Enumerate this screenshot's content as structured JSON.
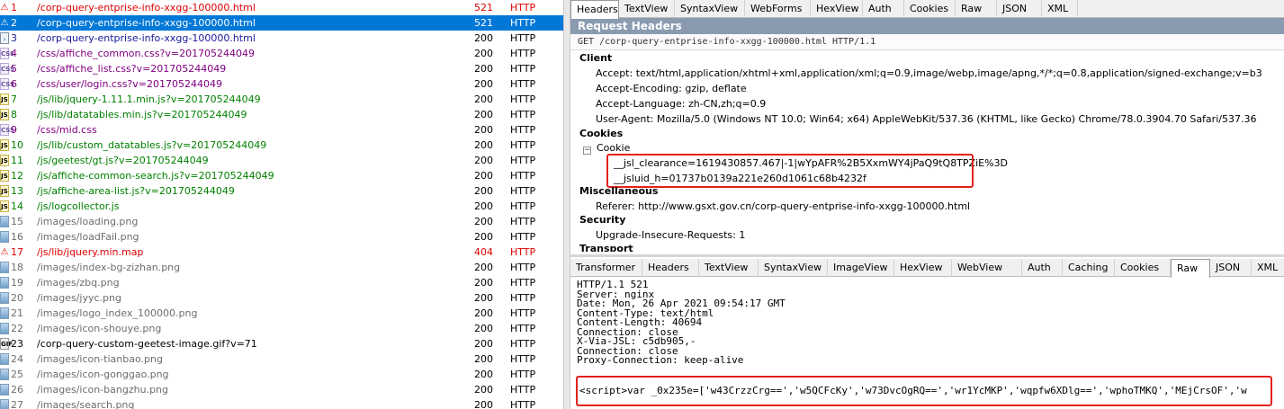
{
  "sessions": [
    {
      "num": "1",
      "icon": "warning-icon",
      "url": "/corp-query-entprise-info-xxgg-100000.html",
      "result": "521",
      "protocol": "HTTP",
      "color": "red"
    },
    {
      "num": "2",
      "icon": "warning-icon",
      "url": "/corp-query-entprise-info-xxgg-100000.html",
      "result": "521",
      "protocol": "HTTP",
      "color": "red",
      "selected": true
    },
    {
      "num": "3",
      "icon": "document-icon",
      "url": "/corp-query-entprise-info-xxgg-100000.html",
      "result": "200",
      "protocol": "HTTP",
      "color": "blue"
    },
    {
      "num": "4",
      "icon": "css-icon",
      "url": "/css/affiche_common.css?v=201705244049",
      "result": "200",
      "protocol": "HTTP",
      "color": "purple"
    },
    {
      "num": "5",
      "icon": "css-icon",
      "url": "/css/affiche_list.css?v=201705244049",
      "result": "200",
      "protocol": "HTTP",
      "color": "purple"
    },
    {
      "num": "6",
      "icon": "css-icon",
      "url": "/css/user/login.css?v=201705244049",
      "result": "200",
      "protocol": "HTTP",
      "color": "purple"
    },
    {
      "num": "7",
      "icon": "js-icon",
      "url": "/js/lib/jquery-1.11.1.min.js?v=201705244049",
      "result": "200",
      "protocol": "HTTP",
      "color": "green"
    },
    {
      "num": "8",
      "icon": "js-icon",
      "url": "/js/lib/datatables.min.js?v=201705244049",
      "result": "200",
      "protocol": "HTTP",
      "color": "green"
    },
    {
      "num": "9",
      "icon": "css-icon",
      "url": "/css/mid.css",
      "result": "200",
      "protocol": "HTTP",
      "color": "purple"
    },
    {
      "num": "10",
      "icon": "js-icon",
      "url": "/js/lib/custom_datatables.js?v=201705244049",
      "result": "200",
      "protocol": "HTTP",
      "color": "green"
    },
    {
      "num": "11",
      "icon": "js-icon",
      "url": "/js/geetest/gt.js?v=201705244049",
      "result": "200",
      "protocol": "HTTP",
      "color": "green"
    },
    {
      "num": "12",
      "icon": "js-icon",
      "url": "/js/affiche-common-search.js?v=201705244049",
      "result": "200",
      "protocol": "HTTP",
      "color": "green"
    },
    {
      "num": "13",
      "icon": "js-icon",
      "url": "/js/affiche-area-list.js?v=201705244049",
      "result": "200",
      "protocol": "HTTP",
      "color": "green"
    },
    {
      "num": "14",
      "icon": "js-icon",
      "url": "/js/logcollector.js",
      "result": "200",
      "protocol": "HTTP",
      "color": "green"
    },
    {
      "num": "15",
      "icon": "image-icon",
      "url": "/images/loading.png",
      "result": "200",
      "protocol": "HTTP",
      "color": "gray"
    },
    {
      "num": "16",
      "icon": "image-icon",
      "url": "/images/loadFail.png",
      "result": "200",
      "protocol": "HTTP",
      "color": "gray"
    },
    {
      "num": "17",
      "icon": "warning-icon",
      "url": "/js/lib/jquery.min.map",
      "result": "404",
      "protocol": "HTTP",
      "color": "red"
    },
    {
      "num": "18",
      "icon": "image-icon",
      "url": "/images/index-bg-zizhan.png",
      "result": "200",
      "protocol": "HTTP",
      "color": "gray"
    },
    {
      "num": "19",
      "icon": "image-icon",
      "url": "/images/zbq.png",
      "result": "200",
      "protocol": "HTTP",
      "color": "gray"
    },
    {
      "num": "20",
      "icon": "image-icon",
      "url": "/images/jyyc.png",
      "result": "200",
      "protocol": "HTTP",
      "color": "gray"
    },
    {
      "num": "21",
      "icon": "image-icon",
      "url": "/images/logo_index_100000.png",
      "result": "200",
      "protocol": "HTTP",
      "color": "gray"
    },
    {
      "num": "22",
      "icon": "image-icon",
      "url": "/images/icon-shouye.png",
      "result": "200",
      "protocol": "HTTP",
      "color": "gray"
    },
    {
      "num": "23",
      "icon": "gif-icon",
      "url": "/corp-query-custom-geetest-image.gif?v=71",
      "result": "200",
      "protocol": "HTTP",
      "color": "black"
    },
    {
      "num": "24",
      "icon": "image-icon",
      "url": "/images/icon-tianbao.png",
      "result": "200",
      "protocol": "HTTP",
      "color": "gray"
    },
    {
      "num": "25",
      "icon": "image-icon",
      "url": "/images/icon-gonggao.png",
      "result": "200",
      "protocol": "HTTP",
      "color": "gray"
    },
    {
      "num": "26",
      "icon": "image-icon",
      "url": "/images/icon-bangzhu.png",
      "result": "200",
      "protocol": "HTTP",
      "color": "gray"
    },
    {
      "num": "27",
      "icon": "image-icon",
      "url": "/images/search.png",
      "result": "200",
      "protocol": "HTTP",
      "color": "gray"
    }
  ],
  "request": {
    "tabs": [
      "Headers",
      "TextView",
      "SyntaxView",
      "WebForms",
      "HexView",
      "Auth",
      "Cookies",
      "Raw",
      "JSON",
      "XML"
    ],
    "active_tab": "Headers",
    "title": "Request Headers",
    "request_line": "GET /corp-query-entprise-info-xxgg-100000.html HTTP/1.1",
    "client_label": "Client",
    "client_headers": [
      "Accept: text/html,application/xhtml+xml,application/xml;q=0.9,image/webp,image/apng,*/*;q=0.8,application/signed-exchange;v=b3",
      "Accept-Encoding: gzip, deflate",
      "Accept-Language: zh-CN,zh;q=0.9",
      "User-Agent: Mozilla/5.0 (Windows NT 10.0; Win64; x64) AppleWebKit/537.36 (KHTML, like Gecko) Chrome/78.0.3904.70 Safari/537.36"
    ],
    "cookies_label": "Cookies",
    "cookie_node": "Cookie",
    "cookie_values": [
      "__jsl_clearance=1619430857.467|-1|wYpAFR%2B5XxmWY4jPaQ9tQ8TPZiE%3D",
      "__jsluid_h=01737b0139a221e260d1061c68b4232f"
    ],
    "misc_label": "Miscellaneous",
    "referer": "Referer: http://www.gsxt.gov.cn/corp-query-entprise-info-xxgg-100000.html",
    "security_label": "Security",
    "security_header": "Upgrade-Insecure-Requests: 1",
    "transport_label": "Transport"
  },
  "response": {
    "tabs": [
      "Transformer",
      "Headers",
      "TextView",
      "SyntaxView",
      "ImageView",
      "HexView",
      "WebView",
      "Auth",
      "Caching",
      "Cookies",
      "Raw",
      "JSON",
      "XML"
    ],
    "active_tab": "Raw",
    "raw_lines": [
      "HTTP/1.1 521",
      "Server: nginx",
      "Date: Mon, 26 Apr 2021 09:54:17 GMT",
      "Content-Type: text/html",
      "Content-Length: 40694",
      "Connection: close",
      "X-Via-JSL: c5db905,-",
      "Connection: close",
      "Proxy-Connection: keep-alive"
    ],
    "script_line": "<script>var _0x235e=['w43CrzzCrg==','w5QCFcKy','w73DvcOgRQ==','wr1YcMKP','wqpfw6XDlg==','wphoTMKQ','MEjCrsOF','w"
  }
}
